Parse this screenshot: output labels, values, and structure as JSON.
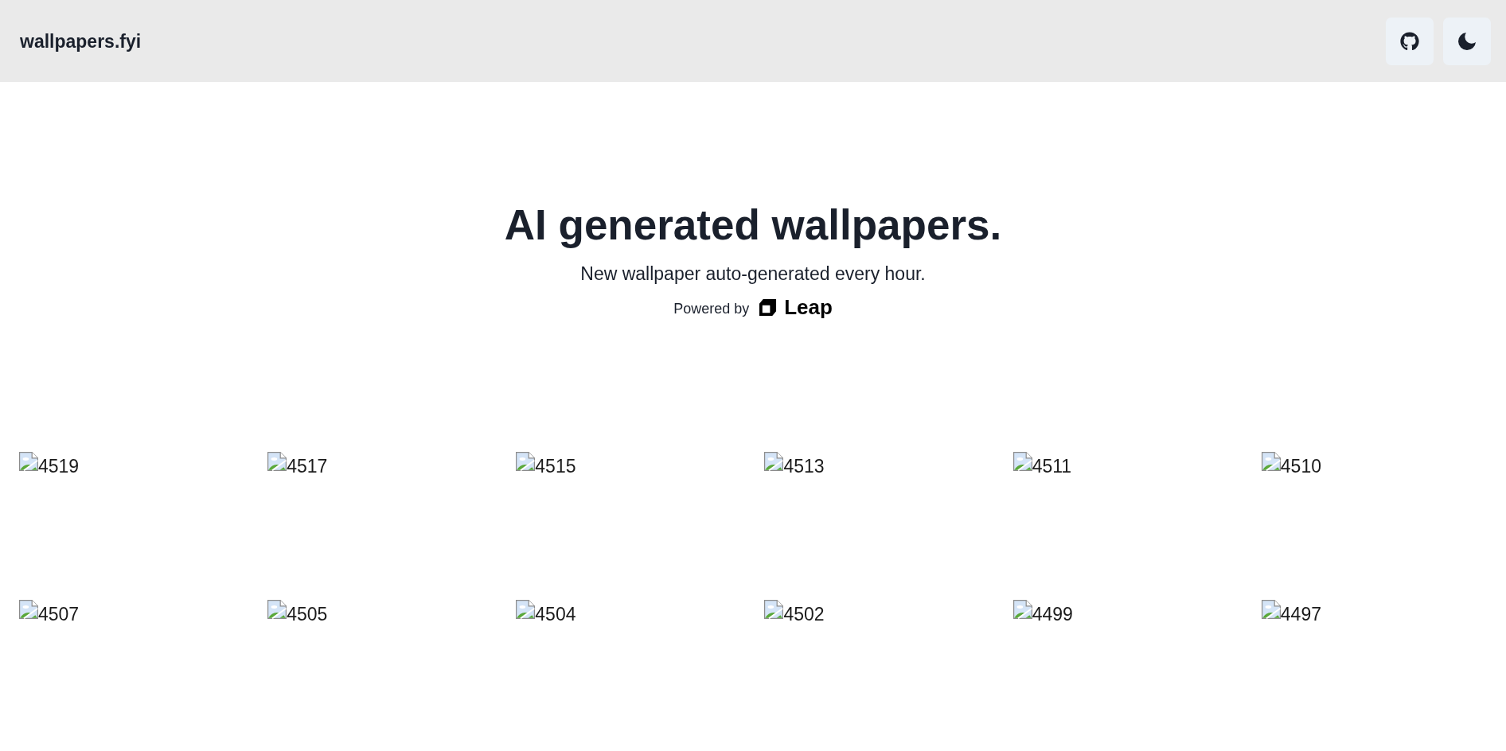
{
  "header": {
    "logo": "wallpapers.fyi",
    "buttons": [
      {
        "kind": "github"
      },
      {
        "kind": "theme_toggle"
      }
    ]
  },
  "hero": {
    "title": "AI generated wallpapers.",
    "subtitle": "New wallpaper auto-generated every hour.",
    "powered_by": {
      "label": "Powered by",
      "brand": "Leap"
    }
  },
  "gallery": {
    "items": [
      {
        "alt": "4519"
      },
      {
        "alt": "4517"
      },
      {
        "alt": "4515"
      },
      {
        "alt": "4513"
      },
      {
        "alt": "4511"
      },
      {
        "alt": "4510"
      },
      {
        "alt": "4507"
      },
      {
        "alt": "4505"
      },
      {
        "alt": "4504"
      },
      {
        "alt": "4502"
      },
      {
        "alt": "4499"
      },
      {
        "alt": "4497"
      }
    ]
  }
}
